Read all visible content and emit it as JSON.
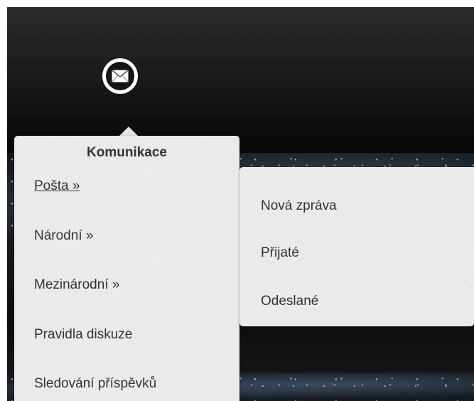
{
  "menu": {
    "title": "Komunikace",
    "items": [
      {
        "label": "Pošta »",
        "active": true
      },
      {
        "label": "Národní »",
        "active": false
      },
      {
        "label": "Mezinárodní »",
        "active": false
      },
      {
        "label": "Pravidla diskuze",
        "active": false
      },
      {
        "label": "Sledování příspěvků",
        "active": false
      }
    ]
  },
  "submenu": {
    "items": [
      {
        "label": "Nová zpráva"
      },
      {
        "label": "Přijaté"
      },
      {
        "label": "Odeslané"
      }
    ]
  },
  "icons": {
    "mail": "envelope-icon"
  },
  "colors": {
    "menu_background": "#e8e8e8",
    "menu_text": "#333333",
    "topbar": "#1b1b1b"
  }
}
